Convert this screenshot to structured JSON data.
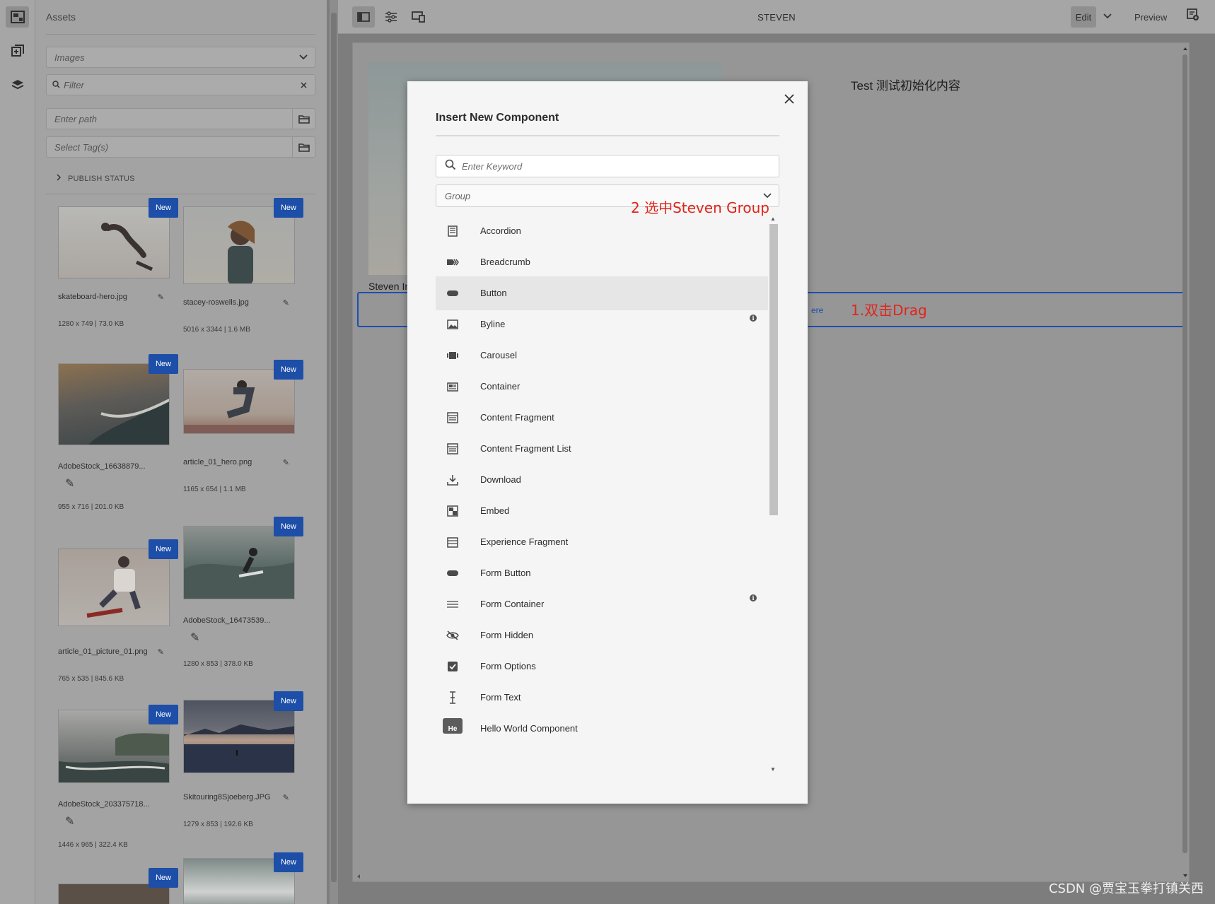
{
  "rail": {
    "icons": [
      "assets-icon",
      "components-icon",
      "layers-icon"
    ]
  },
  "panel": {
    "title": "Assets",
    "type_select": "Images",
    "filter_placeholder": "Filter",
    "path_placeholder": "Enter path",
    "tags_placeholder": "Select Tag(s)",
    "publish_status": "PUBLISH STATUS",
    "badge": "New",
    "assets": [
      {
        "name": "skateboard-hero.jpg",
        "meta": "1280 x 749 | 73.0 KB"
      },
      {
        "name": "stacey-roswells.jpg",
        "meta": "5016 x 3344 | 1.6 MB"
      },
      {
        "name": "AdobeStock_16638879...",
        "meta": "955 x 716 | 201.0 KB"
      },
      {
        "name": "article_01_hero.png",
        "meta": "1165 x 654 | 1.1 MB"
      },
      {
        "name": "article_01_picture_01.png",
        "meta": "765 x 535 | 845.6 KB"
      },
      {
        "name": "AdobeStock_16473539...",
        "meta": "1280 x 853 | 378.0 KB"
      },
      {
        "name": "AdobeStock_203375718...",
        "meta": "1446 x 965 | 322.4 KB"
      },
      {
        "name": "Skitouring8Sjoeberg.JPG",
        "meta": "1279 x 853 | 192.6 KB"
      }
    ]
  },
  "toolbar": {
    "title": "STEVEN",
    "edit": "Edit",
    "preview": "Preview"
  },
  "page": {
    "text": "Test 测试初始化内容",
    "caption": "Steven In",
    "drag_hint": "ere",
    "annotation_drag": "1.双击Drag"
  },
  "modal": {
    "title": "Insert New Component",
    "search_placeholder": "Enter Keyword",
    "group_placeholder": "Group",
    "annotation_group": "2 选中Steven Group",
    "items": [
      {
        "label": "Accordion",
        "icon": "accordion-icon"
      },
      {
        "label": "Breadcrumb",
        "icon": "breadcrumb-icon"
      },
      {
        "label": "Button",
        "icon": "button-icon"
      },
      {
        "label": "Byline",
        "icon": "image-icon"
      },
      {
        "label": "Carousel",
        "icon": "carousel-icon"
      },
      {
        "label": "Container",
        "icon": "container-icon"
      },
      {
        "label": "Content Fragment",
        "icon": "content-fragment-icon"
      },
      {
        "label": "Content Fragment List",
        "icon": "content-fragment-list-icon"
      },
      {
        "label": "Download",
        "icon": "download-icon"
      },
      {
        "label": "Embed",
        "icon": "embed-icon"
      },
      {
        "label": "Experience Fragment",
        "icon": "experience-fragment-icon"
      },
      {
        "label": "Form Button",
        "icon": "button-icon"
      },
      {
        "label": "Form Container",
        "icon": "form-container-icon"
      },
      {
        "label": "Form Hidden",
        "icon": "eye-hidden-icon"
      },
      {
        "label": "Form Options",
        "icon": "checkbox-icon"
      },
      {
        "label": "Form Text",
        "icon": "text-cursor-icon"
      },
      {
        "label": "Hello World Component",
        "icon": "he-icon",
        "icon_text": "He"
      }
    ],
    "hovered": "Button",
    "info_items": [
      "Byline",
      "Form Container"
    ]
  },
  "watermark": "CSDN @贾宝玉拳打镇关西"
}
